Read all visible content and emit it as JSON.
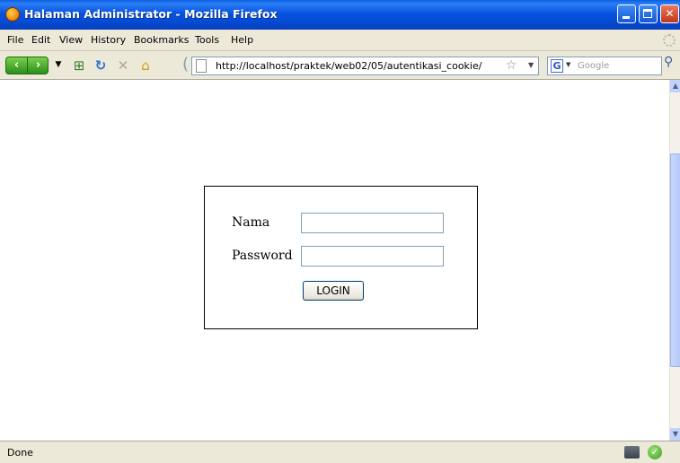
{
  "window": {
    "title": "Halaman Administrator - Mozilla Firefox"
  },
  "menu": {
    "items": [
      "File",
      "Edit",
      "View",
      "History",
      "Bookmarks",
      "Tools",
      "Help"
    ]
  },
  "toolbar": {
    "url": "http://localhost/praktek/web02/05/autentikasi_cookie/",
    "search_engine_letter": "G",
    "search_placeholder": "Google"
  },
  "form": {
    "name_label": "Nama",
    "password_label": "Password",
    "name_value": "",
    "password_value": "",
    "login_label": "LOGIN"
  },
  "status": {
    "text": "Done"
  },
  "colors": {
    "titlebar": "#0754e0",
    "nav_green": "#2a8f1c"
  }
}
